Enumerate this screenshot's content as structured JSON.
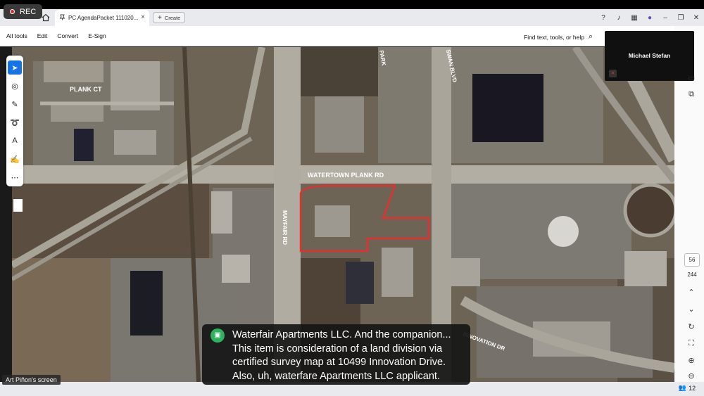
{
  "recording": {
    "label": "REC"
  },
  "browser": {
    "tab_title": "PC AgendaPacket 111020...",
    "create_label": "Create"
  },
  "toolbar": {
    "menu": [
      "All tools",
      "Edit",
      "Convert",
      "E-Sign"
    ],
    "find_label": "Find text, tools, or help"
  },
  "map": {
    "street_labels": {
      "plank_ct": "PLANK CT",
      "watertown_plank": "WATERTOWN PLANK RD",
      "mayfair": "MAYFAIR RD",
      "swan": "SWAN BLVD",
      "innovation": "INNOVATION DR",
      "park": "PARK"
    },
    "boundary_color": "#e53030"
  },
  "video": {
    "participant_name": "Michael Stefan"
  },
  "pager": {
    "current_page": "56",
    "total_pages": "244"
  },
  "caption": {
    "lines": [
      "Waterfair Apartments LLC. And the companion...",
      "This item is consideration of a land division via",
      "certified survey map at 10499 Innovation Drive.",
      "Also, uh, waterfare Apartments LLC applicant."
    ]
  },
  "screen_share": {
    "label": "Art Piñon's screen"
  },
  "participants": {
    "count": "12"
  }
}
